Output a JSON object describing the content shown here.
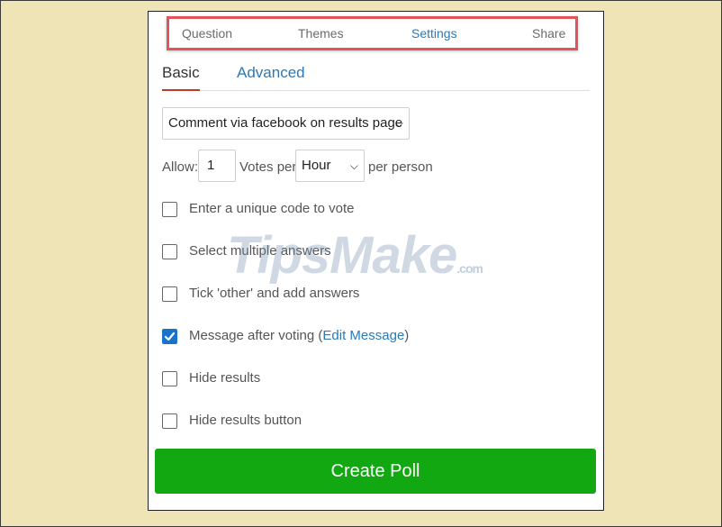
{
  "steps": [
    {
      "label": "Question",
      "active": false
    },
    {
      "label": "Themes",
      "active": false
    },
    {
      "label": "Settings",
      "active": true
    },
    {
      "label": "Share",
      "active": false
    }
  ],
  "subtabs": {
    "basic": "Basic",
    "advanced": "Advanced"
  },
  "comment_select": {
    "value": "Comment via facebook on results page"
  },
  "allow_row": {
    "allow_label": "Allow:",
    "votes_value": "1",
    "votes_label": "Votes per",
    "period_value": "Hour",
    "per_person_label": "per person"
  },
  "options": [
    {
      "label": "Enter a unique code to vote",
      "checked": false
    },
    {
      "label": "Select multiple answers",
      "checked": false
    },
    {
      "label": "Tick 'other' and add answers",
      "checked": false
    },
    {
      "label": "Message after voting (",
      "checked": true,
      "link": "Edit Message",
      "suffix": ")"
    },
    {
      "label": "Hide results",
      "checked": false
    },
    {
      "label": "Hide results button",
      "checked": false
    }
  ],
  "create_button": "Create Poll",
  "watermark": {
    "main": "TipsMake",
    "suffix": ".com"
  },
  "colors": {
    "background": "#efe4b6",
    "accent_blue": "#2a7ab8",
    "button_green": "#12a812",
    "highlight_red": "#e2545c"
  }
}
